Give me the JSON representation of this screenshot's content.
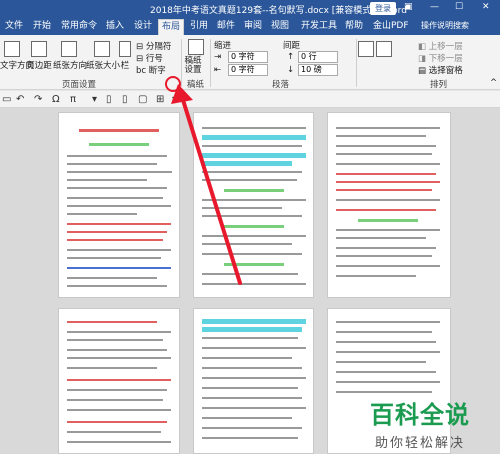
{
  "window": {
    "title": "2018年中考语文真题129套--名句默写.docx [兼容模式] - Word",
    "login": "登录"
  },
  "tabs": [
    "文件",
    "开始",
    "常用命令",
    "插入",
    "设计",
    "布局",
    "引用",
    "邮件",
    "审阅",
    "视图",
    "开发工具",
    "帮助",
    "金山PDF",
    "操作说明搜索"
  ],
  "active_tab": "布局",
  "ribbon": {
    "text_direction": "文字方向",
    "margins": "页边距",
    "orientation": "纸张方向",
    "size": "纸张大小",
    "columns": "栏",
    "breaks": "分隔符",
    "line_numbers": "行号",
    "hyphenation": "断字",
    "page_setup_group": "页面设置",
    "draft_paper": "稿纸设置",
    "draft_group": "稿纸",
    "indent_label": "缩进",
    "spacing_label": "间距",
    "indent_left": "0 字符",
    "indent_right": "0 字符",
    "space_before": "0 行",
    "space_after": "10 磅",
    "paragraph_group": "段落",
    "bring_forward": "上移一层",
    "send_backward": "下移一层",
    "selection_pane": "选择窗格",
    "arrange_group": "排列"
  },
  "watermark": {
    "main": "百科全说",
    "sub": "助你轻松解决"
  },
  "colors": {
    "title_bar": "#2b579a",
    "arrow": "#e8192c",
    "watermark": "#1a9b50"
  }
}
